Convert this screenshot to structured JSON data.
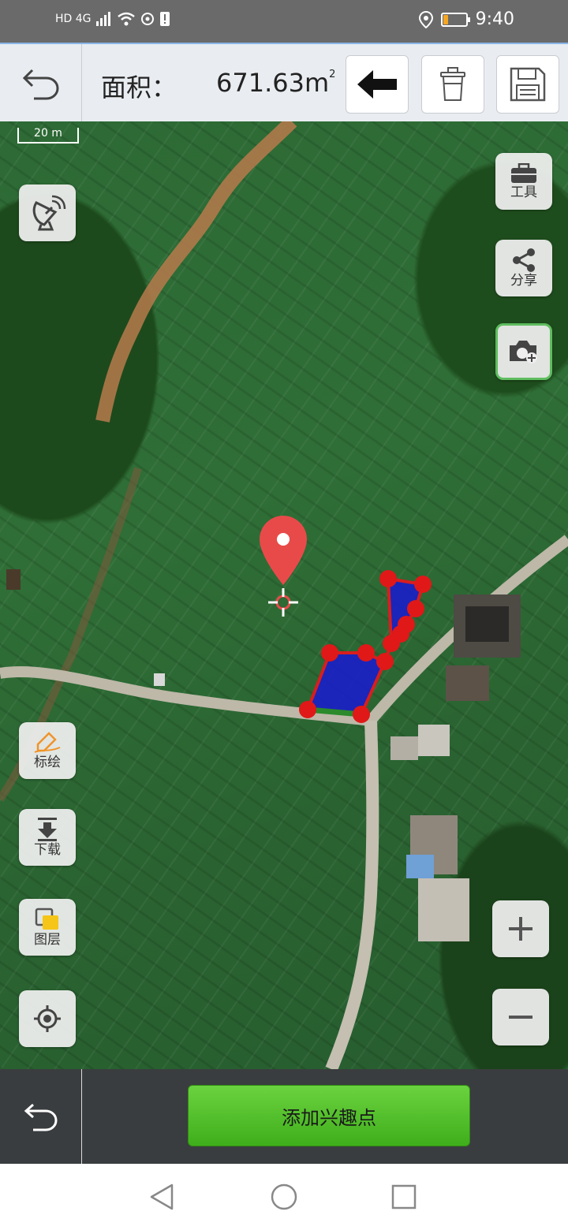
{
  "status_bar": {
    "network": "HD 4G",
    "time": "9:40",
    "battery_percent": 20
  },
  "toolbar": {
    "area_label": "面积：",
    "area_value": "671.63",
    "area_unit": "m",
    "area_unit_sup": "2"
  },
  "map": {
    "scale_label": "20 m",
    "polygon_fill": "#1a1ec8",
    "polygon_stroke": "#d81e1e",
    "pin_color": "#e84a4a"
  },
  "side_buttons": {
    "tools_label": "工具",
    "share_label": "分享",
    "draw_label": "标绘",
    "download_label": "下载",
    "layers_label": "图层"
  },
  "bottom": {
    "add_poi_label": "添加兴趣点"
  },
  "colors": {
    "add_poi_green": "#4cbd25",
    "toolbar_bg": "#e9edf1"
  }
}
